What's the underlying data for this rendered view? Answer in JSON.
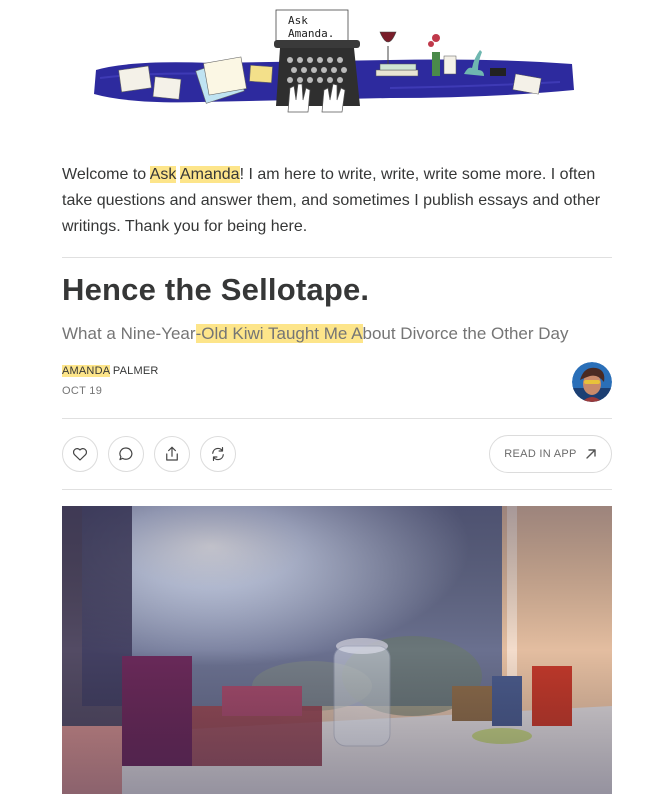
{
  "banner": {
    "sign_line1": "Ask",
    "sign_line2": "Amanda."
  },
  "intro": {
    "prefix": "Welcome to ",
    "highlight1": "Ask",
    "space": " ",
    "highlight2": "Amanda",
    "suffix": "! I am here to write, write, write some more. I often take questions and answer them, and sometimes I publish essays and other writings. Thank you for being here."
  },
  "post": {
    "title": "Hence the Sellotape.",
    "subtitle_pre": "What a Nine-Year",
    "subtitle_highlight": "-Old Kiwi Taught Me A",
    "subtitle_post": "bout Divorce the Other Day",
    "author_first": "AMANDA",
    "author_last": " PALMER",
    "date": "OCT 19"
  },
  "actions": {
    "read_in_app": "READ IN APP"
  },
  "colors": {
    "highlight": "#fde58a",
    "banner_blue": "#2d2a9e",
    "text": "#363737",
    "muted": "#757575"
  },
  "icons": [
    "heart-icon",
    "comment-icon",
    "share-icon",
    "restack-icon",
    "arrow-up-right-icon"
  ]
}
